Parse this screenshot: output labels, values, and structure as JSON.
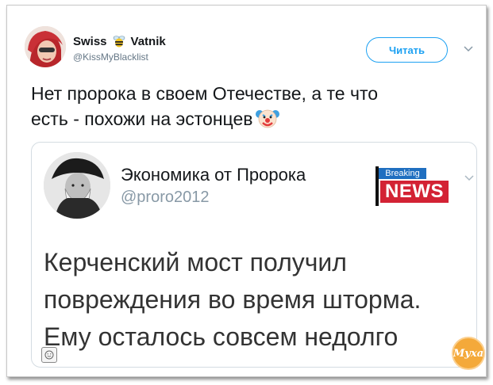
{
  "author": {
    "name_left": "Swiss",
    "name_right": "Vatnik",
    "handle": "@KissMyBlacklist"
  },
  "follow_button": {
    "label": "Читать"
  },
  "tweet": {
    "line1": "Нет пророка в своем Отечестве, а те что",
    "line2": "есть - похожи на эстонцев"
  },
  "quoted": {
    "name": "Экономика от Пророка",
    "handle": "@proro2012",
    "logo": {
      "top": "Breaking",
      "bottom": "NEWS"
    },
    "body_lines": [
      "Керченский мост получил",
      "повреждения во время шторма.",
      "Ему осталось совсем недолго"
    ]
  },
  "watermark": {
    "text": "Муха"
  },
  "colors": {
    "accent": "#1da1f2",
    "news_red": "#d32234",
    "breaking_blue": "#1f6fc0",
    "watermark": "#f4a93a"
  },
  "icons": [
    "bee-emoji-icon",
    "clown-emoji-icon",
    "chevron-down-icon",
    "smile-icon"
  ]
}
